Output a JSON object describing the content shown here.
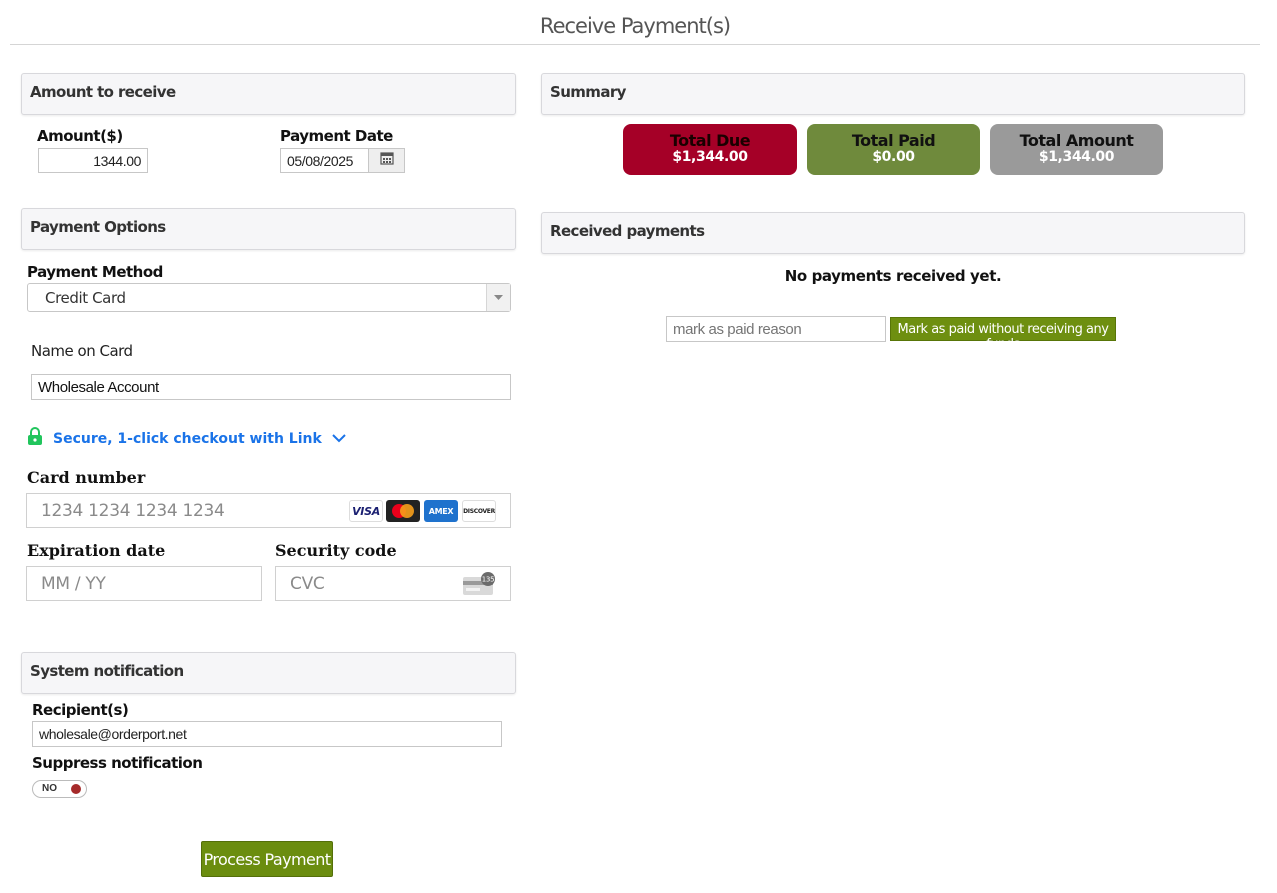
{
  "page": {
    "title": "Receive Payment(s)"
  },
  "amount_panel": {
    "heading": "Amount to receive",
    "amount_label": "Amount($)",
    "amount_value": "1344.00",
    "date_label": "Payment Date",
    "date_value": "05/08/2025"
  },
  "options_panel": {
    "heading": "Payment Options",
    "method_label": "Payment Method",
    "method_value": "Credit Card",
    "name_label": "Name on Card",
    "name_value": "Wholesale Account",
    "link_text": "Secure, 1-click checkout with Link",
    "card_number_label": "Card number",
    "card_number_placeholder": "1234 1234 1234 1234",
    "card_brands": [
      "VISA",
      "mastercard",
      "AMEX",
      "DISCOVER"
    ],
    "expiration_label": "Expiration date",
    "expiration_placeholder": "MM / YY",
    "security_label": "Security code",
    "security_placeholder": "CVC",
    "cvc_icon_text": "135"
  },
  "notification_panel": {
    "heading": "System notification",
    "recipients_label": "Recipient(s)",
    "recipients_value": "wholesale@orderport.net",
    "suppress_label": "Suppress notification",
    "suppress_toggle": "NO"
  },
  "process_button": "Process Payment",
  "summary_panel": {
    "heading": "Summary",
    "tiles": [
      {
        "label": "Total Due",
        "value": "$1,344.00",
        "bg": "#a50027",
        "fg": "#ffffff",
        "label_color": "#1a0000"
      },
      {
        "label": "Total Paid",
        "value": "$0.00",
        "bg": "#6f8a3c",
        "fg": "#ffffff",
        "label_color": "#111111"
      },
      {
        "label": "Total Amount",
        "value": "$1,344.00",
        "bg": "#9a9a9a",
        "fg": "#ffffff",
        "label_color": "#111111"
      }
    ]
  },
  "received_panel": {
    "heading": "Received payments",
    "empty_text": "No payments received yet.",
    "reason_placeholder": "mark as paid reason",
    "mark_paid_button": "Mark as paid without receiving any funds"
  },
  "colors": {
    "accent_green": "#6e8f10",
    "link_blue": "#1a73e8",
    "lock_green": "#21c55d"
  }
}
